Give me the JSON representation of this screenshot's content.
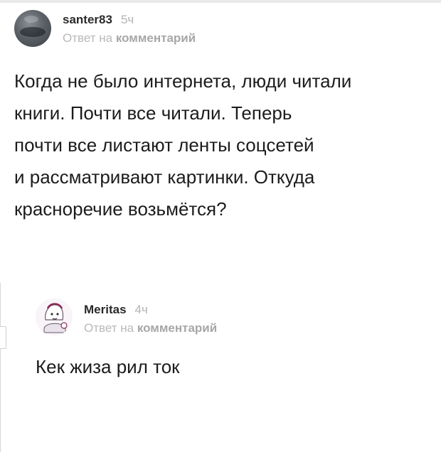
{
  "comments": [
    {
      "username": "santer83",
      "time": "5ч",
      "reply_prefix": "Ответ на",
      "reply_link": "комментарий",
      "text": "Когда не было интернета, люди читали\nкниги. Почти все читали. Теперь\nпочти все листают ленты соцсетей\nи рассматривают картинки. Откуда\nкрасноречие возьмётся?",
      "avatar": "photo-avatar"
    },
    {
      "username": "Meritas",
      "time": "4ч",
      "reply_prefix": "Ответ на",
      "reply_link": "комментарий",
      "text": "Кек жиза рил ток",
      "avatar": "cartoon-avatar"
    }
  ],
  "colors": {
    "text": "#1c1c1c",
    "meta": "#b4b4b4",
    "thread_line": "#d8d8d8"
  }
}
